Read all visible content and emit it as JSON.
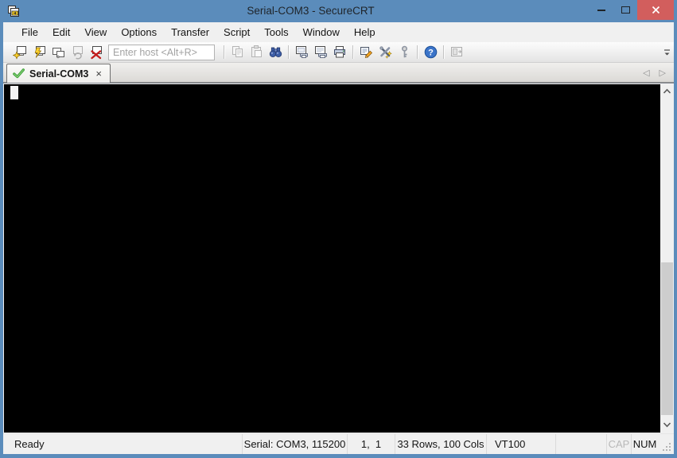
{
  "window": {
    "title": "Serial-COM3 - SecureCRT"
  },
  "menu": {
    "items": [
      "File",
      "Edit",
      "View",
      "Options",
      "Transfer",
      "Script",
      "Tools",
      "Window",
      "Help"
    ]
  },
  "toolbar": {
    "host_placeholder": "Enter host <Alt+R>",
    "host_value": "",
    "icons": [
      "connect",
      "quick-connect",
      "connect-in-tab",
      "reconnect",
      "disconnect",
      "copy",
      "paste",
      "find",
      "print-screen",
      "print-preview",
      "print",
      "session-options",
      "global-options",
      "key-agent",
      "help",
      "session-manager"
    ]
  },
  "tabbar": {
    "tabs": [
      {
        "label": "Serial-COM3",
        "close_glyph": "×",
        "status_icon": "green-check-icon"
      }
    ],
    "scroll_left_glyph": "◁",
    "scroll_right_glyph": "▷"
  },
  "terminal": {
    "content": "",
    "cursor_style": "block"
  },
  "statusbar": {
    "ready": "Ready",
    "serial": "Serial: COM3, 115200",
    "cursor_position": "1,  1",
    "grid_size": "33 Rows, 100 Cols",
    "emulation": "VT100",
    "cap_label": "CAP",
    "num_label": "NUM"
  },
  "colors": {
    "titlebar_blue": "#5b8cbb",
    "close_button_red": "#d25e5d",
    "terminal_background": "#000000",
    "tab_check_green": "#3fa23a",
    "chrome_gray": "#f0f0f0"
  }
}
